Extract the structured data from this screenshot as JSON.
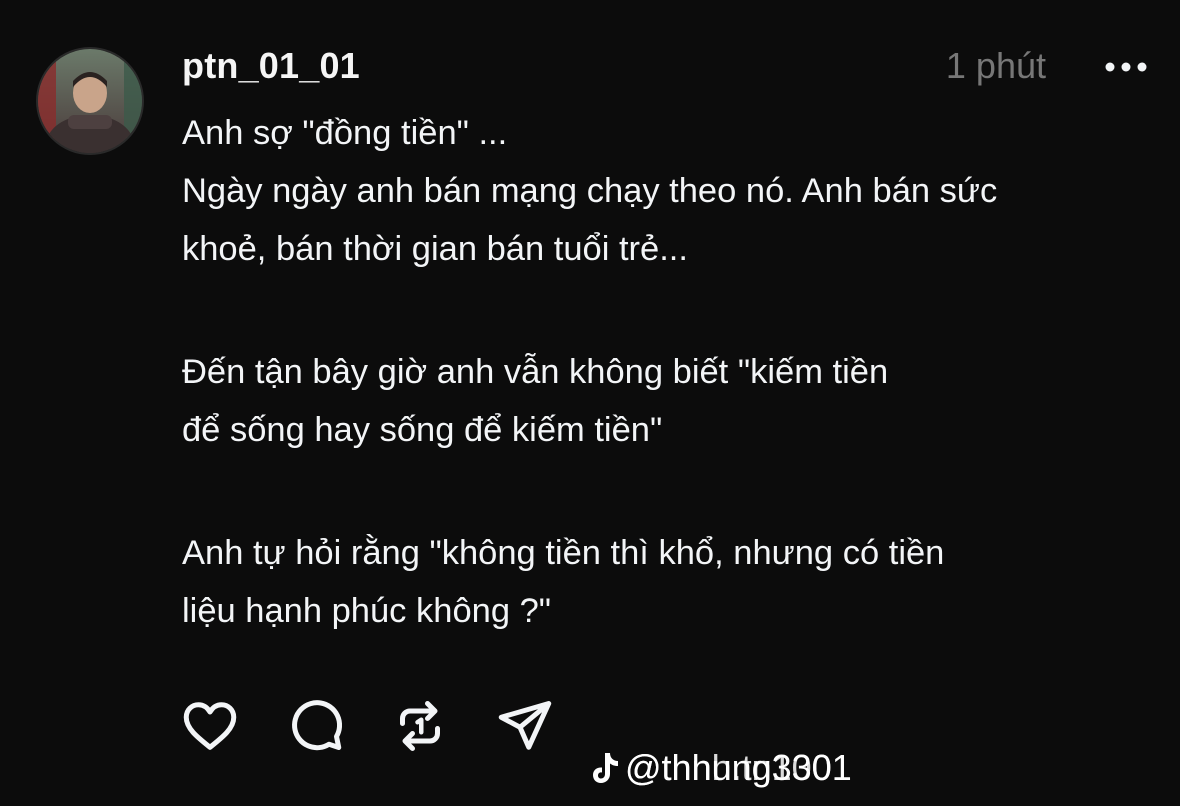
{
  "post": {
    "username": "ptn_01_01",
    "time": "1 phút",
    "paragraphs": [
      "Anh sợ \"đồng tiền\" ...\nNgày ngày anh bán mạng chạy theo nó. Anh bán sức\nkhoẻ, bán thời gian bán tuổi trẻ...",
      "Đến tận bây giờ anh vẫn không biết \"kiếm tiền\nđể sống hay sống để kiếm tiền\"",
      "Anh tự hỏi rằng \"không tiền thì khổ, nhưng có tiền\nliệu hạnh phúc không ?\""
    ]
  },
  "actions": {
    "like_icon": "heart-icon",
    "comment_icon": "comment-icon",
    "repost_icon": "repost-icon",
    "share_icon": "send-icon"
  },
  "watermark": {
    "logo_icon": "tiktok-icon",
    "handle_a": "@thhung3301",
    "handle_b": "@thnh.tn100"
  },
  "colors": {
    "background": "#0c0c0c",
    "text": "#f3f5f7",
    "muted": "#777777"
  }
}
